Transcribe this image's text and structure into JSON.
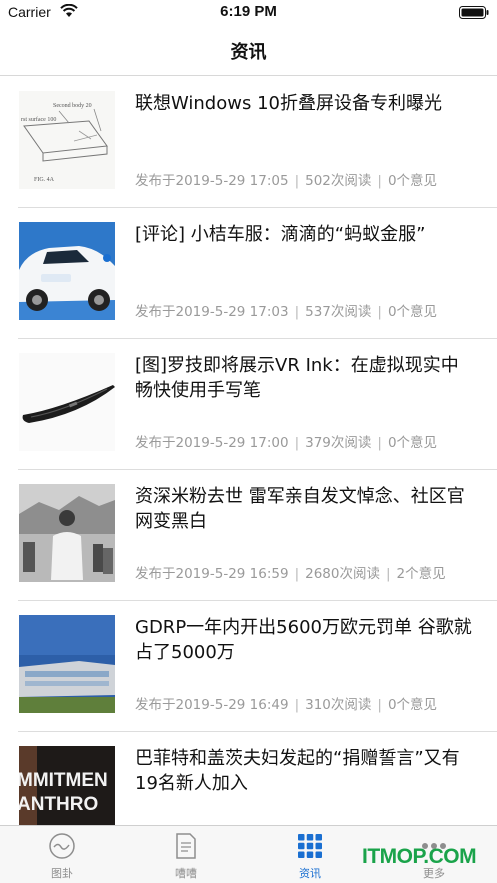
{
  "status_bar": {
    "carrier": "Carrier",
    "time": "6:19 PM"
  },
  "nav": {
    "title": "资讯"
  },
  "articles": [
    {
      "title": "联想Windows 10折叠屏设备专利曝光",
      "date": "发布于2019-5-29 17:05",
      "reads": "502次阅读",
      "comments": "0个意见",
      "thumb_icon": "patent-drawing-thumbnail"
    },
    {
      "title": "[评论] 小桔车服：滴滴的“蚂蚁金服”",
      "date": "发布于2019-5-29 17:03",
      "reads": "537次阅读",
      "comments": "0个意见",
      "thumb_icon": "white-car-thumbnail"
    },
    {
      "title": "[图]罗技即将展示VR Ink：在虚拟现实中畅快使用手写笔",
      "date": "发布于2019-5-29 17:00",
      "reads": "379次阅读",
      "comments": "0个意见",
      "thumb_icon": "vr-stylus-thumbnail"
    },
    {
      "title": "资深米粉去世 雷军亲自发文悼念、社区官网变黑白",
      "date": "发布于2019-5-29 16:59",
      "reads": "2680次阅读",
      "comments": "2个意见",
      "thumb_icon": "bw-photo-thumbnail"
    },
    {
      "title": "GDRP一年内开出5600万欧元罚单 谷歌就占了5000万",
      "date": "发布于2019-5-29 16:49",
      "reads": "310次阅读",
      "comments": "0个意见",
      "thumb_icon": "building-thumbnail"
    },
    {
      "title": "巴菲特和盖茨夫妇发起的“捐赠誓言”又有19名新人加入",
      "thumb_text_1": "MMITMEN",
      "thumb_text_2": "ANTHRO",
      "thumb_icon": "giving-pledge-thumbnail"
    }
  ],
  "tabs": [
    {
      "label": "图卦",
      "icon": "chart-circle-icon"
    },
    {
      "label": "嘈嘈",
      "icon": "document-icon"
    },
    {
      "label": "资讯",
      "icon": "grid-icon",
      "active": true
    },
    {
      "label": "更多",
      "icon": "more-dots-icon"
    }
  ],
  "watermark": "ITMOP.COM",
  "colors": {
    "accent": "#1a6fd1",
    "meta_text": "#9a9a9a",
    "watermark": "#1aa34a"
  }
}
